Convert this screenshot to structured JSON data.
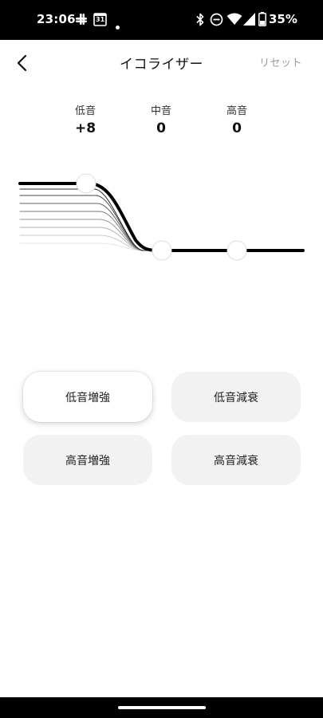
{
  "status_bar": {
    "time": "23:06",
    "calendar_day": "31",
    "battery_percent": "35%"
  },
  "header": {
    "title": "イコライザー",
    "reset_label": "リセット"
  },
  "bands": [
    {
      "label": "低音",
      "value": "+8"
    },
    {
      "label": "中音",
      "value": "0"
    },
    {
      "label": "高音",
      "value": "0"
    }
  ],
  "presets": [
    {
      "label": "低音増強",
      "active": true
    },
    {
      "label": "低音減衰",
      "active": false
    },
    {
      "label": "高音増強",
      "active": false
    },
    {
      "label": "高音減衰",
      "active": false
    }
  ],
  "colors": {
    "accent": "#000000",
    "preset_bg": "#f2f2f2",
    "muted_text": "#9a9a9a"
  }
}
